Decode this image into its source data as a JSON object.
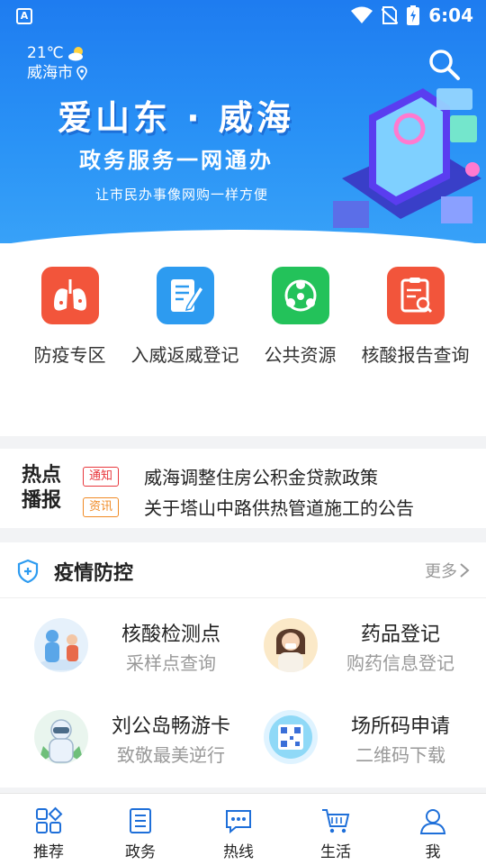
{
  "status": {
    "time": "6:04",
    "app_icon": "A"
  },
  "weather": {
    "temp": "21℃",
    "city": "威海市"
  },
  "banner": {
    "slogan_main": "爱山东 · 威海",
    "slogan_sub": "政务服务一网通办",
    "slogan_small": "让市民办事像网购一样方便"
  },
  "quick": [
    {
      "label": "防疫专区",
      "icon": "lungs-icon",
      "color": "#f2553b"
    },
    {
      "label": "入威返威登记",
      "icon": "edit-icon",
      "color": "#2d9bf0"
    },
    {
      "label": "公共资源",
      "icon": "network-icon",
      "color": "#23c25a"
    },
    {
      "label": "核酸报告查询",
      "icon": "report-search-icon",
      "color": "#f2553b"
    }
  ],
  "hot": {
    "title_line1": "热点",
    "title_line2": "播报",
    "items": [
      {
        "tag": "通知",
        "text": "威海调整住房公积金贷款政策"
      },
      {
        "tag": "资讯",
        "text": "关于塔山中路供热管道施工的公告"
      }
    ]
  },
  "epidemic": {
    "title": "疫情防控",
    "more": "更多",
    "services": [
      {
        "title": "核酸检测点",
        "subtitle": "采样点查询"
      },
      {
        "title": "药品登记",
        "subtitle": "购药信息登记"
      },
      {
        "title": "刘公岛畅游卡",
        "subtitle": "致敬最美逆行"
      },
      {
        "title": "场所码申请",
        "subtitle": "二维码下载"
      }
    ]
  },
  "nav": [
    {
      "label": "推荐",
      "icon": "recommend-icon"
    },
    {
      "label": "政务",
      "icon": "document-list-icon"
    },
    {
      "label": "热线",
      "icon": "chat-icon"
    },
    {
      "label": "生活",
      "icon": "cart-icon"
    },
    {
      "label": "我",
      "icon": "user-icon"
    }
  ],
  "colors": {
    "accent": "#1e7cf0",
    "notice": "#e8383d",
    "info": "#f08a24"
  }
}
